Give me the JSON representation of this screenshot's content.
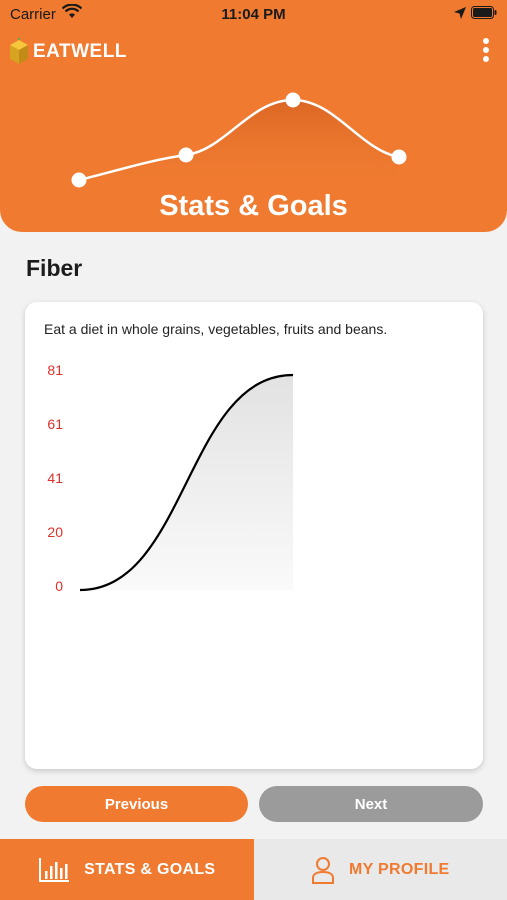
{
  "status_bar": {
    "carrier": "Carrier",
    "time": "11:04 PM"
  },
  "app": {
    "logo_text": "EATWELL"
  },
  "header": {
    "title": "Stats & Goals"
  },
  "section": {
    "title": "Fiber"
  },
  "card": {
    "description": "Eat a diet in whole grains, vegetables, fruits and beans."
  },
  "chart_data": {
    "type": "area",
    "yticks": [
      "81",
      "61",
      "41",
      "20",
      "0"
    ],
    "x": [
      0,
      1
    ],
    "values": [
      0,
      81
    ],
    "ylim": [
      0,
      81
    ],
    "tick_color": "#e0302a",
    "line_color": "#000000"
  },
  "buttons": {
    "previous": "Previous",
    "next": "Next"
  },
  "tabs": [
    {
      "label": "STATS & GOALS",
      "icon": "bar-chart-icon"
    },
    {
      "label": "MY PROFILE",
      "icon": "person-icon"
    }
  ],
  "colors": {
    "accent": "#ef7a30",
    "next_button": "#9b9b9b",
    "tab_inactive": "#e9e9e9"
  }
}
